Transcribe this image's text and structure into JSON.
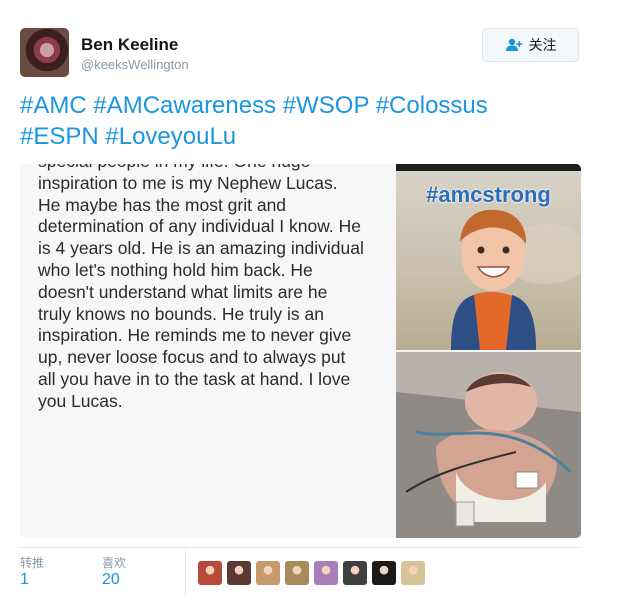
{
  "user": {
    "display_name": "Ben Keeline",
    "screen_name": "@keeksWellington",
    "avatar_icon": "profile-photo"
  },
  "follow_button": {
    "label": "关注",
    "icon": "add-user-icon"
  },
  "tweet": {
    "hashtags": [
      "#AMC",
      "#AMCawareness",
      "#WSOP",
      "#Colossus",
      "#ESPN",
      "#LoveyouLu"
    ]
  },
  "media": {
    "note_text": "special people in my life. One huge\ninspiration to me is my Nephew Lucas.\nHe maybe has the most grit and\ndetermination of any individual I know. He\nis 4 years old. He is an amazing individual\nwho let's nothing hold him back. He\ndoesn't understand what limits are he\ntruly knows no bounds. He truly is an\ninspiration. He reminds me to never give\nup, never loose focus and to always put\nall you have in to the task at hand. I love\nyou Lucas.",
    "photo_top_overlay": "#amcstrong"
  },
  "stats": {
    "retweets_label": "转推",
    "retweets_count": "1",
    "likes_label": "喜欢",
    "likes_count": "20"
  },
  "likers": [
    {
      "name": "liker-avatar-1",
      "color": "#b84a3c"
    },
    {
      "name": "liker-avatar-2",
      "color": "#5a3a33"
    },
    {
      "name": "liker-avatar-3",
      "color": "#c79a6e"
    },
    {
      "name": "liker-avatar-4",
      "color": "#a88b5a"
    },
    {
      "name": "liker-avatar-5",
      "color": "#a77fb6"
    },
    {
      "name": "liker-avatar-6",
      "color": "#3f3f3f"
    },
    {
      "name": "liker-avatar-7",
      "color": "#1f1a1a"
    },
    {
      "name": "liker-avatar-8",
      "color": "#d9c49a"
    }
  ],
  "colors": {
    "link": "#1b95e0",
    "muted": "#8899a6",
    "text": "#14171a"
  }
}
